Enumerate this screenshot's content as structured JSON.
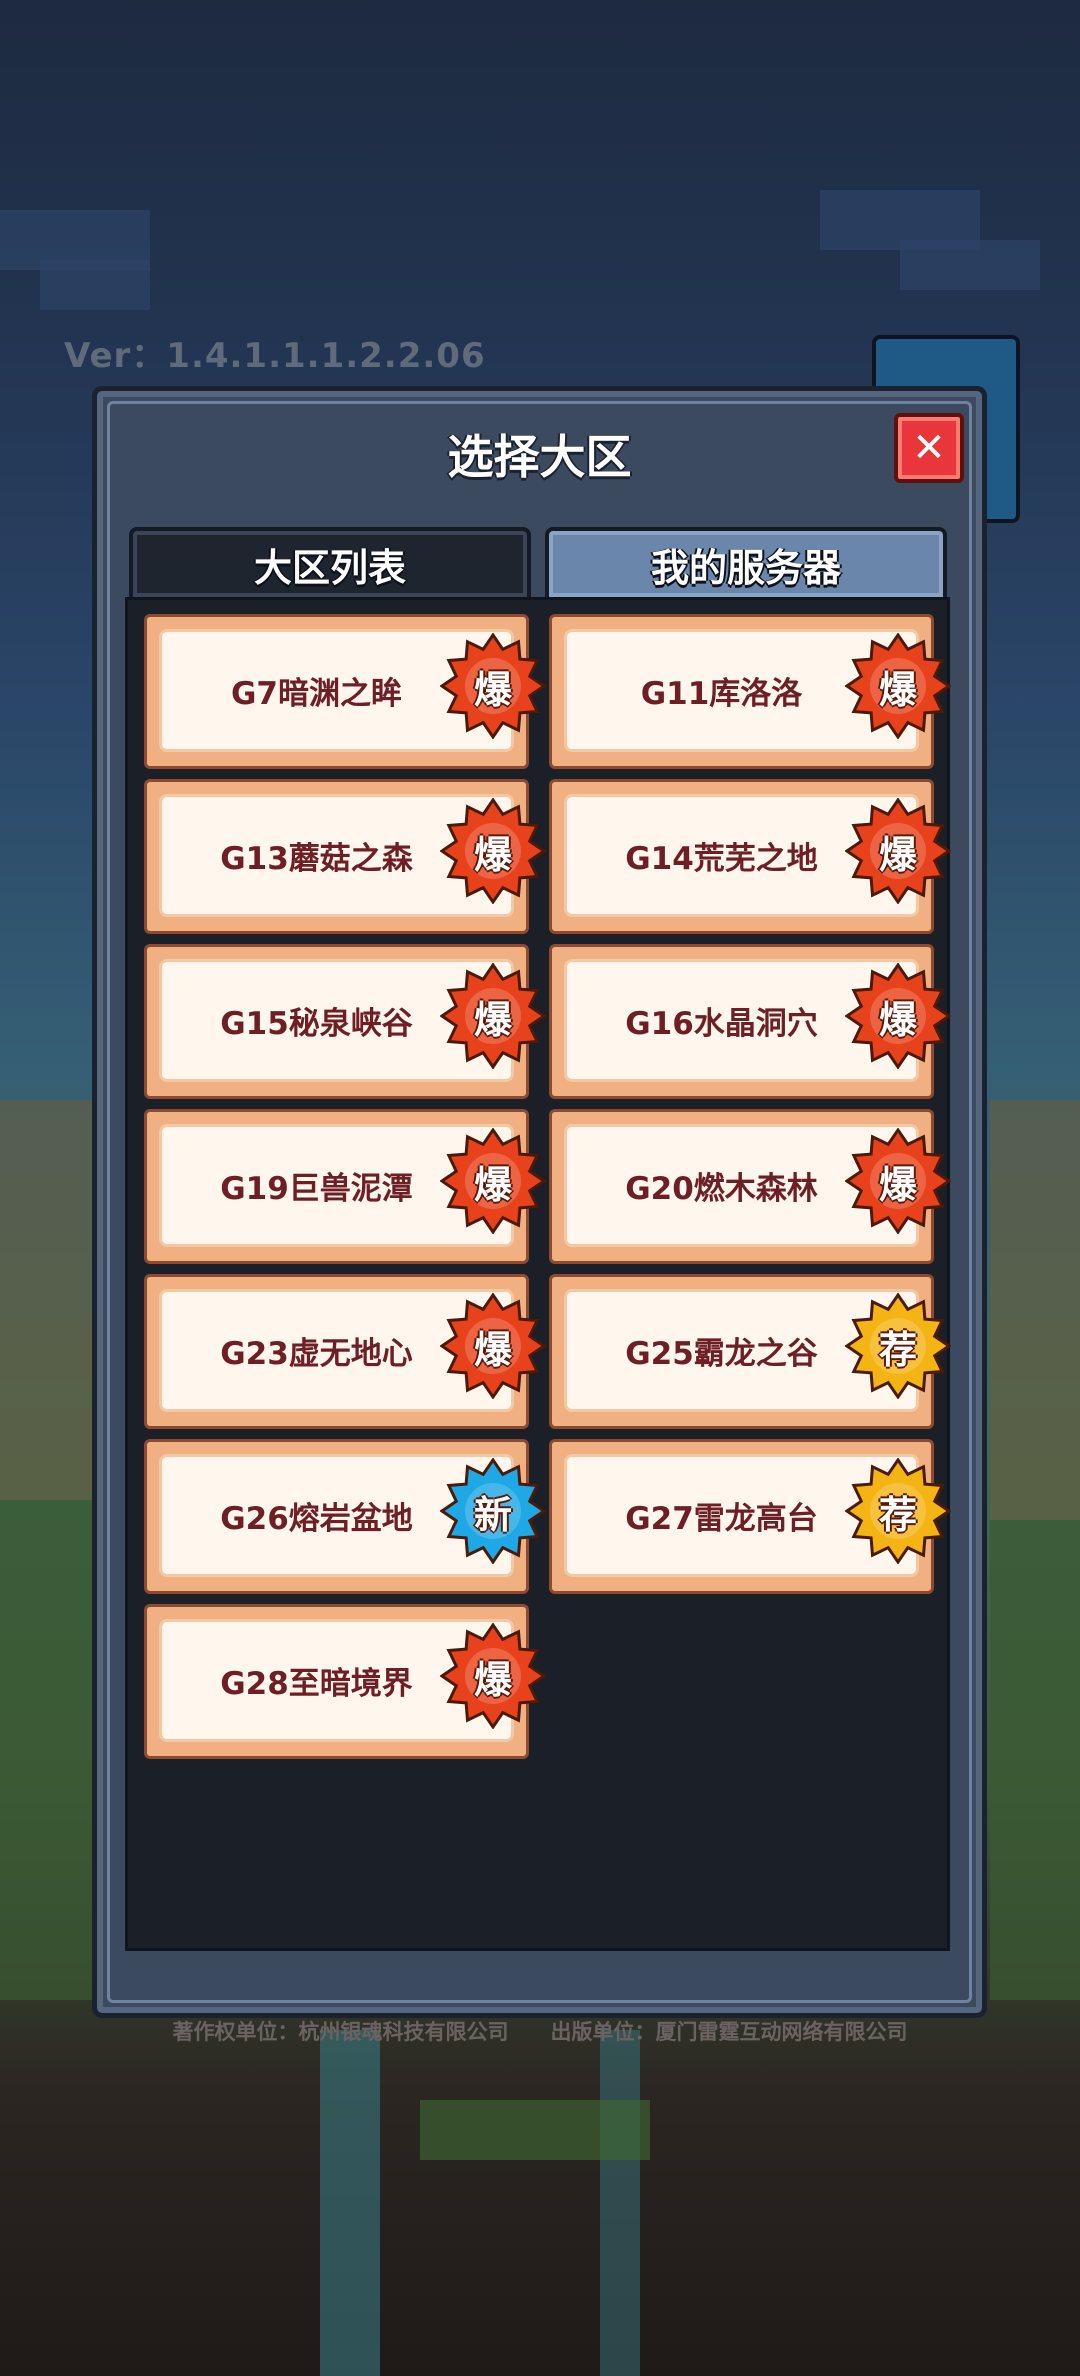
{
  "version": "Ver：1.4.1.1.1.2.2.06",
  "dialog": {
    "title": "选择大区",
    "tabs": [
      {
        "label": "大区列表",
        "active": true
      },
      {
        "label": "我的服务器",
        "active": false
      }
    ]
  },
  "servers": [
    {
      "name": "G7暗渊之眸",
      "badge": "爆",
      "badge_type": "hot"
    },
    {
      "name": "G11库洛洛",
      "badge": "爆",
      "badge_type": "hot"
    },
    {
      "name": "G13蘑菇之森",
      "badge": "爆",
      "badge_type": "hot"
    },
    {
      "name": "G14荒芜之地",
      "badge": "爆",
      "badge_type": "hot"
    },
    {
      "name": "G15秘泉峡谷",
      "badge": "爆",
      "badge_type": "hot"
    },
    {
      "name": "G16水晶洞穴",
      "badge": "爆",
      "badge_type": "hot"
    },
    {
      "name": "G19巨兽泥潭",
      "badge": "爆",
      "badge_type": "hot"
    },
    {
      "name": "G20燃木森林",
      "badge": "爆",
      "badge_type": "hot"
    },
    {
      "name": "G23虚无地心",
      "badge": "爆",
      "badge_type": "hot"
    },
    {
      "name": "G25霸龙之谷",
      "badge": "荐",
      "badge_type": "recommend"
    },
    {
      "name": "G26熔岩盆地",
      "badge": "新",
      "badge_type": "new"
    },
    {
      "name": "G27雷龙高台",
      "badge": "荐",
      "badge_type": "recommend"
    },
    {
      "name": "G28至暗境界",
      "badge": "爆",
      "badge_type": "hot"
    }
  ],
  "footer": {
    "copyright": "著作权单位：杭州银魂科技有限公司　　出版单位：厦门雷霆互动网络有限公司"
  },
  "colors": {
    "hot": "#e8421c",
    "recommend": "#f4b414",
    "new": "#1fa8e6"
  }
}
